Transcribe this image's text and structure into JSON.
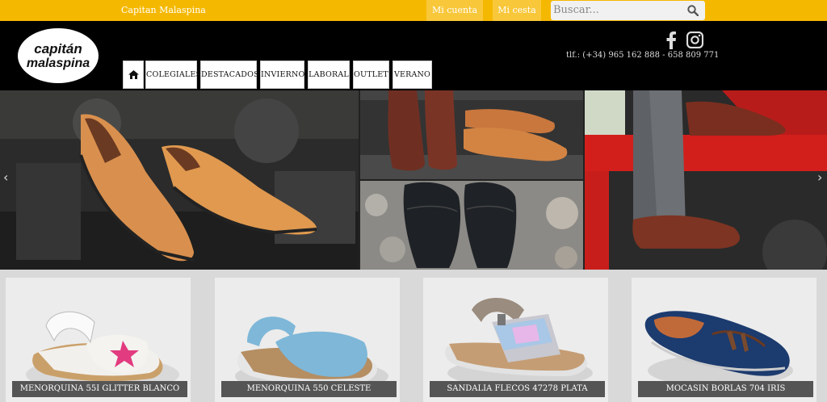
{
  "topbar": {
    "brand": "Capitan Malaspina",
    "account": "Mi cuenta",
    "cart": "Mi cesta",
    "search_placeholder": "Buscar..."
  },
  "header": {
    "logo_line1": "capitán",
    "logo_line2": "malaspina",
    "phone": "tlf.: (+34) 965 162 888 - 658 809 771"
  },
  "nav": [
    "COLEGIALES",
    "DESTACADOS",
    "INVIERNO",
    "LABORAL",
    "OUTLET",
    "VERANO"
  ],
  "slider": {
    "prev": "‹",
    "next": "›"
  },
  "products": [
    {
      "name": "MENORQUINA 55I GLITTER BLANCO"
    },
    {
      "name": "MENORQUINA 550 CELESTE"
    },
    {
      "name": "SANDALIA FLECOS 47278 PLATA"
    },
    {
      "name": "MOCASIN BORLAS 704 IRIS"
    }
  ],
  "colors": {
    "topbar": "#f5b800",
    "header": "#000000",
    "label": "#555555"
  }
}
